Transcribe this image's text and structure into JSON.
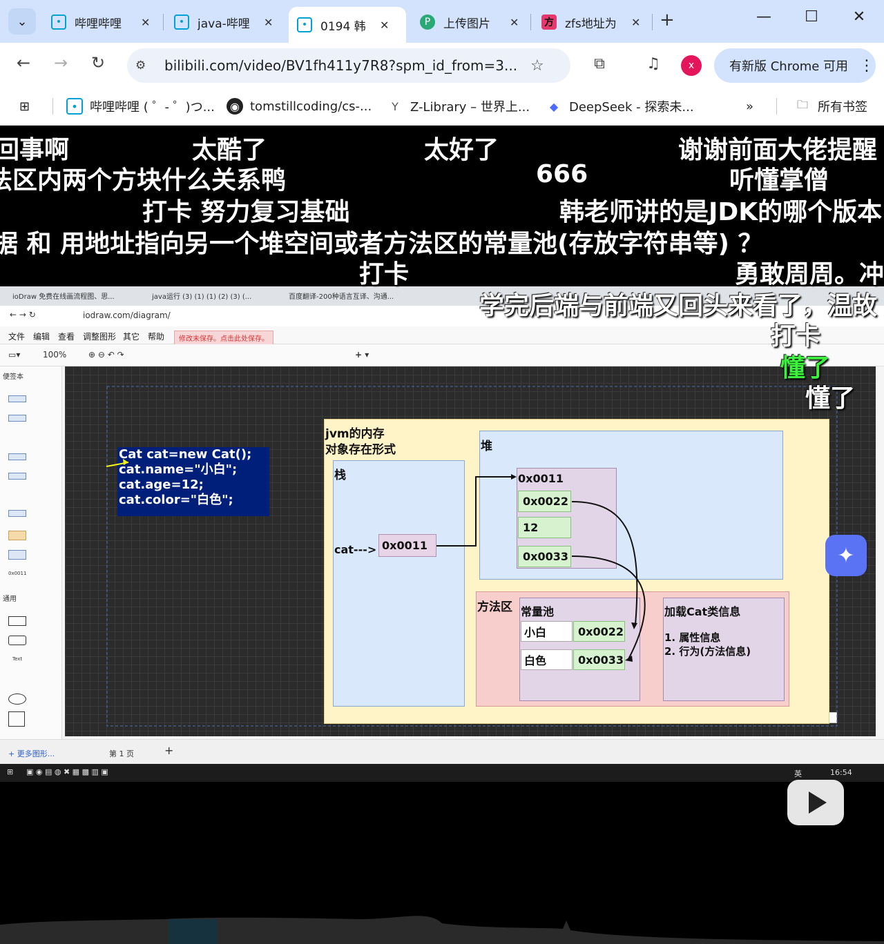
{
  "browser": {
    "tabs": [
      {
        "title": "哔哩哔哩",
        "favicon": "bilibili-icon"
      },
      {
        "title": "java-哔哩",
        "favicon": "bilibili-icon"
      },
      {
        "title": "0194 韩",
        "favicon": "bilibili-icon",
        "active": true
      },
      {
        "title": "上传图片",
        "favicon": "upload-icon"
      },
      {
        "title": "zfs地址为",
        "favicon": "fang-icon"
      }
    ],
    "new_tab": "+",
    "url": "bilibili.com/video/BV1fh411y7R8?spm_id_from=3...",
    "profile_initial": "x",
    "update_label": "有新版 Chrome 可用",
    "bookmarks": [
      {
        "label": "哔哩哔哩 ( ゜- ゜)つ...",
        "icon": "bilibili-icon"
      },
      {
        "label": "tomstillcoding/cs-...",
        "icon": "github-icon"
      },
      {
        "label": "Z-Library – 世界上...",
        "icon": "zlibrary-icon"
      },
      {
        "label": "DeepSeek - 探索未...",
        "icon": "deepseek-icon"
      }
    ],
    "more_bookmarks": "»",
    "all_bookmarks": "所有书签"
  },
  "danmaku": [
    "回事啊",
    "太酷了",
    "太好了",
    "谢谢前面大佬提醒",
    "法区内两个方块什么关系鸭",
    "666",
    "听懂掌僧",
    "打卡  努力复习基础",
    "韩老师讲的是JDK的哪个版本",
    "据  和  用地址指向另一个堆空间或者方法区的常量池(存放字符串等) ？",
    "打卡",
    "勇敢周周。冲",
    "学完后端与前端又回头来看了，温故",
    "打卡",
    "懂了",
    "懂了"
  ],
  "recording": {
    "tabs": [
      "ioDraw 免费在线画流程图、思...",
      "java运行 (3) (1) (1) (2) (3) (...",
      "百度翻译-200种语言互译、沟通..."
    ],
    "url": "iodraw.com/diagram/",
    "menu": [
      "文件",
      "编辑",
      "查看",
      "调整图形",
      "其它",
      "帮助"
    ],
    "warning": "修改未保存。点击此处保存。",
    "zoom": "100%",
    "panel_title": "便签本",
    "panel_general": "通用",
    "more_shapes": "+ 更多图形...",
    "page_tab": "第 1 页",
    "clock": "16:54",
    "ime": "英",
    "shape_text": "Text",
    "shape_label": "0x0011"
  },
  "diagram": {
    "code_lines": [
      "Cat cat=new Cat();",
      "cat.name=\"小白\";",
      "cat.age=12;",
      "cat.color=\"白色\";"
    ],
    "jvm_title_1": "jvm的内存",
    "jvm_title_2": "对象存在形式",
    "stack_label": "栈",
    "heap_label": "堆",
    "method_label": "方法区",
    "pool_label": "常量池",
    "class_info_label": "加载Cat类信息",
    "class_info_1": "1. 属性信息",
    "class_info_2": "2. 行为(方法信息)",
    "stack_ref_label": "cat--->",
    "stack_ref_value": "0x0011",
    "heap_obj_addr": "0x0011",
    "heap_fields": [
      "0x0022",
      "12",
      "0x0033"
    ],
    "pool_entries": [
      {
        "value": "小白",
        "addr": "0x0022"
      },
      {
        "value": "白色",
        "addr": "0x0033"
      }
    ]
  }
}
